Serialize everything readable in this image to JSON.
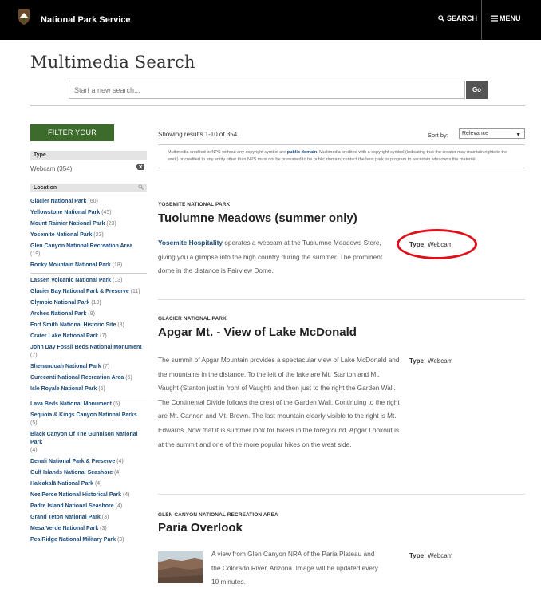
{
  "topbar": {
    "brand": "National Park Service",
    "search_label": "SEARCH",
    "menu_label": "MENU"
  },
  "header": {
    "title": "Multimedia Search",
    "search_placeholder": "Start a new search...",
    "go_label": "Go"
  },
  "sidebar": {
    "filter_button": "FILTER YOUR RESULTS",
    "type_heading": "Type",
    "type_value": "Webcam (354)",
    "location_heading": "Location",
    "locations": [
      {
        "name": "Glacier National Park",
        "count": "(60)"
      },
      {
        "name": "Yellowstone National Park",
        "count": "(45)"
      },
      {
        "name": "Mount Rainier National Park",
        "count": "(23)"
      },
      {
        "name": "Yosemite National Park",
        "count": "(23)"
      },
      {
        "name": "Glen Canyon National Recreation Area",
        "count": "(19)"
      },
      {
        "name": "Rocky Mountain National Park",
        "count": "(18)"
      },
      {
        "name": "Lassen Volcanic National Park",
        "count": "(13)"
      },
      {
        "name": "Glacier Bay National Park & Preserve",
        "count": "(11)"
      },
      {
        "name": "Olympic National Park",
        "count": "(10)"
      },
      {
        "name": "Arches National Park",
        "count": "(9)"
      },
      {
        "name": "Fort Smith National Historic Site",
        "count": "(8)"
      },
      {
        "name": "Crater Lake National Park",
        "count": "(7)"
      },
      {
        "name": "John Day Fossil Beds National Monument",
        "count": "(7)"
      },
      {
        "name": "Shenandoah National Park",
        "count": "(7)"
      },
      {
        "name": "Curecanti National Recreation Area",
        "count": "(6)"
      },
      {
        "name": "Isle Royale National Park",
        "count": "(6)"
      },
      {
        "name": "Lava Beds National Monument",
        "count": "(5)"
      },
      {
        "name": "Sequoia & Kings Canyon National Parks",
        "count": "(5)"
      },
      {
        "name": "Black Canyon Of The Gunnison National Park",
        "count": "(4)"
      },
      {
        "name": "Denali National Park & Preserve",
        "count": "(4)"
      },
      {
        "name": "Gulf Islands National Seashore",
        "count": "(4)"
      },
      {
        "name": "Haleakalā National Park",
        "count": "(4)"
      },
      {
        "name": "Nez Perce National Historical Park",
        "count": "(4)"
      },
      {
        "name": "Padre Island National Seashore",
        "count": "(4)"
      },
      {
        "name": "Grand Teton National Park",
        "count": "(3)"
      },
      {
        "name": "Mesa Verde National Park",
        "count": "(3)"
      },
      {
        "name": "Pea Ridge National Military Park",
        "count": "(3)"
      }
    ]
  },
  "main": {
    "results_count": "Showing results 1-10 of 354",
    "sort_label": "Sort by:",
    "sort_value": "Relevance",
    "notice": {
      "part1": "Multimedia credited to NPS without any copyright symbol are ",
      "link": "public domain",
      "part2": ". Multimedia credited with a copyright symbol (indicating that the creator may maintain rights to the work) or credited to any entity other than NPS must not be presumed to be public domain; contact the host park or program to ascertain who owns the material."
    },
    "results": [
      {
        "park": "YOSEMITE NATIONAL PARK",
        "title": "Tuolumne Meadows (summer only)",
        "link": "Yosemite Hospitality",
        "desc": " operates a webcam at the Tuolumne Meadows Store, giving you a glimpse into the high country during the summer. The prominent dome in the distance is Fairview Dome.",
        "type_label": "Type:",
        "type_value": "Webcam"
      },
      {
        "park": "GLACIER NATIONAL PARK",
        "title": "Apgar Mt. - View of Lake McDonald",
        "desc": "The summit of Apgar Mountain provides a spectacular view of Lake McDonald and the mountains in the distance. To the left of the lake are Mt. Stanton and Mt. Vaught (Stanton just in front of Vaught) and then just to the right the Garden Wall. The Continental Divide follows the crest of the Garden Wall. Continuing to the right are Mt. Cannon and Mt. Brown. The last mountain clearly visible to the right is Mt. Edwards. Now that it is summer look for hikers in the foreground. Apgar Lookout is at the summit and one of the more popular hikes on the west side.",
        "type_label": "Type:",
        "type_value": "Webcam"
      },
      {
        "park": "GLEN CANYON NATIONAL RECREATION AREA",
        "title": "Paria Overlook",
        "desc": "A view from Glen Canyon NRA of the Paria Plateau and the Colorado River, Arizona. Image will be updated every 10 minutes.",
        "type_label": "Type:",
        "type_value": "Webcam"
      }
    ]
  },
  "colors": {
    "topbar": "#000000",
    "filter_button": "#3d6b2b",
    "link": "#1a4b7b",
    "annotation_circle": "#e0101a"
  },
  "icons": [
    "nps-arrowhead-icon",
    "search-icon",
    "menu-icon",
    "clear-filter-icon",
    "location-search-icon",
    "caret-down-icon"
  ]
}
